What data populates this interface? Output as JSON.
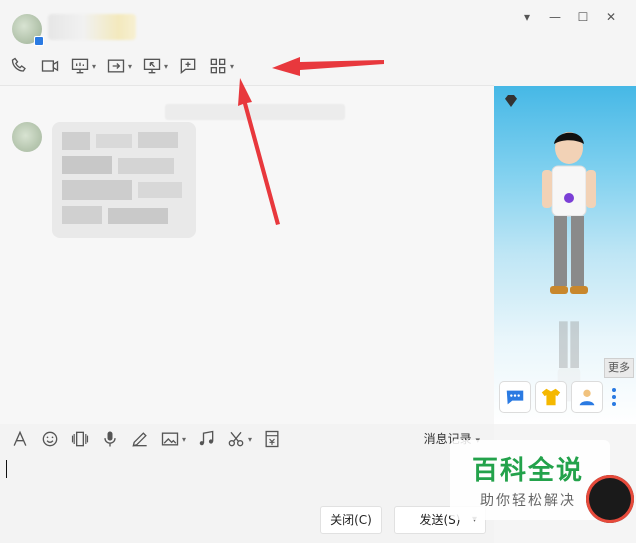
{
  "title_bar": {
    "window_buttons": [
      "▾",
      "—",
      "☐",
      "✕"
    ]
  },
  "toolbar": {
    "items": [
      {
        "icon": "phone-icon"
      },
      {
        "icon": "video-call-icon"
      },
      {
        "icon": "screen-share-icon",
        "dropdown": true
      },
      {
        "icon": "transfer-file-icon",
        "dropdown": true
      },
      {
        "icon": "remote-desktop-icon",
        "dropdown": true
      },
      {
        "icon": "whiteboard-icon"
      },
      {
        "icon": "apps-grid-icon",
        "dropdown": true
      }
    ],
    "dropdown_caret": "▾"
  },
  "sidebar": {
    "more_label": "更多",
    "buttons": [
      "chat-bubble-icon",
      "shirt-icon",
      "person-icon"
    ]
  },
  "input_toolbar": {
    "items": [
      "font-icon",
      "emoji-icon",
      "shake-icon",
      "voice-icon",
      "pen-icon",
      "image-icon",
      "music-icon",
      "screenshot-icon",
      "red-packet-icon"
    ],
    "history_label": "消息记录",
    "history_caret": "▾"
  },
  "footer": {
    "close_label": "关闭(C)",
    "send_label": "发送(S)",
    "send_caret": "▾"
  },
  "watermark": {
    "title": "百科全说",
    "subtitle": "助你轻松解决"
  },
  "colors": {
    "accent": "#2a7ae2",
    "arrow": "#e8383d",
    "watermark_green": "#23a24b"
  }
}
